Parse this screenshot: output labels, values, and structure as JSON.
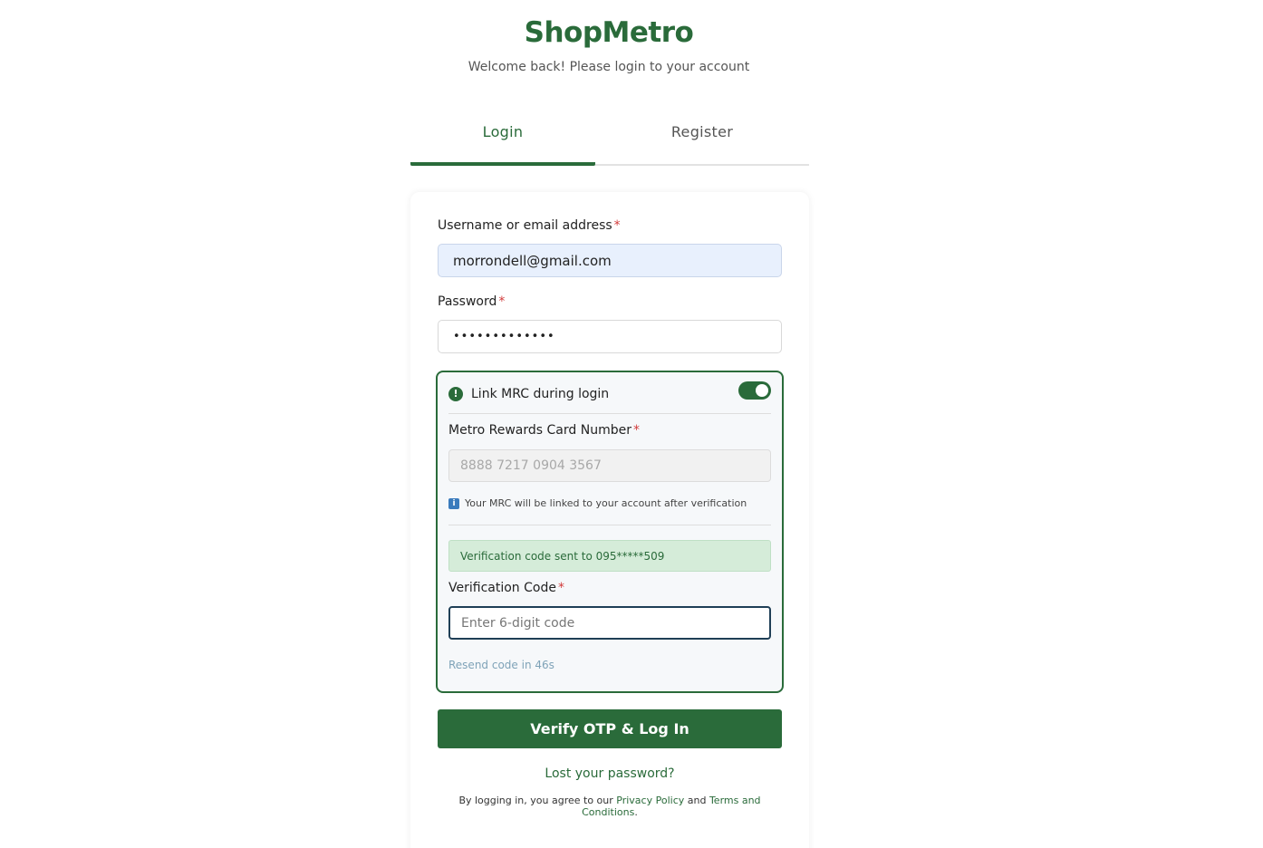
{
  "header": {
    "brand": "ShopMetro",
    "subtitle": "Welcome back! Please login to your account"
  },
  "tabs": [
    {
      "label": "Login",
      "active": true
    },
    {
      "label": "Register",
      "active": false
    }
  ],
  "form": {
    "username": {
      "label": "Username or email address",
      "required_mark": "*",
      "value": "morrondell@gmail.com"
    },
    "password": {
      "label": "Password",
      "required_mark": "*",
      "value": "•••••••••••••"
    },
    "mrc": {
      "icon": "alert-circle-icon",
      "title": "Link MRC during login",
      "toggle_on": true,
      "card_label": "Metro Rewards Card Number",
      "card_required_mark": "*",
      "card_placeholder": "8888 7217 0904 3567",
      "info_icon": "info-icon",
      "info_text": "Your MRC will be linked to your account after verification",
      "success_text": "Verification code sent to 095*****509",
      "code_label": "Verification Code",
      "code_required_mark": "*",
      "code_placeholder": "Enter 6-digit code",
      "resend_text": "Resend code in 46s"
    },
    "submit_label": "Verify OTP & Log In",
    "lost_password": "Lost your password?",
    "legal": {
      "prefix": "By logging in, you agree to our",
      "privacy": "Privacy Policy",
      "and": "and",
      "terms": "Terms and Conditions",
      "suffix": "."
    }
  },
  "colors": {
    "brand_green": "#2a6b3a",
    "required_red": "#d23b3b",
    "success_bg": "#d5ecd9",
    "info_blue": "#3a7bbd",
    "autofill_bg": "#e8f0fd"
  }
}
